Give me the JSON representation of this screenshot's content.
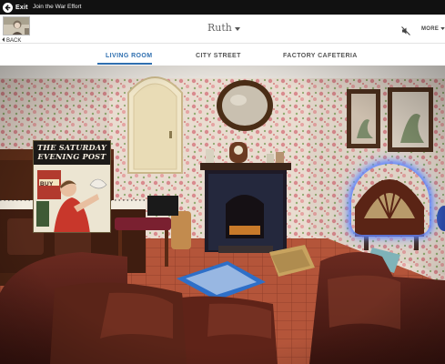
{
  "topbar": {
    "exit_label": "Exit",
    "title": "Join the War Effort"
  },
  "header": {
    "back_label": "BACK",
    "character_name": "Ruth",
    "more_label": "MORE"
  },
  "tabs": [
    {
      "label": "LIVING ROOM",
      "active": true
    },
    {
      "label": "CITY STREET",
      "active": false
    },
    {
      "label": "FACTORY CAFETERIA",
      "active": false
    }
  ],
  "scene": {
    "magazine_title": "THE SATURDAY EVENING POST",
    "magazine_title_line1": "THE SATURDAY",
    "magazine_title_line2": "EVENING POST",
    "poster_text": "BUY"
  },
  "colors": {
    "accent": "#2f6fb0",
    "radio_glow": "#6b8cff"
  }
}
